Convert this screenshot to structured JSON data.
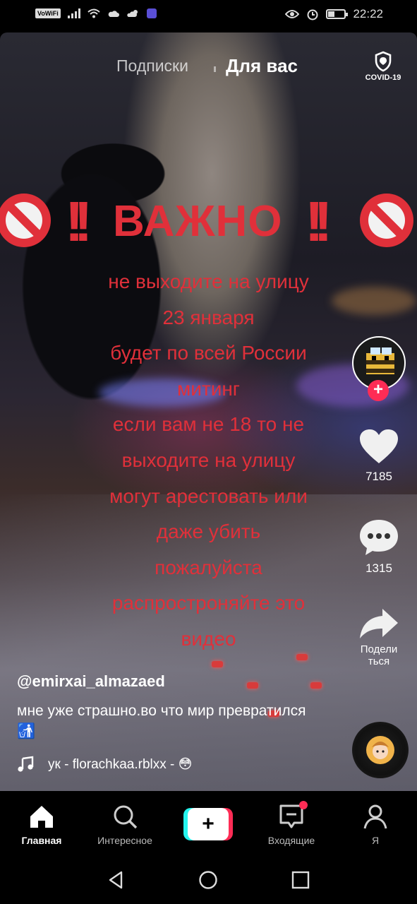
{
  "status_bar": {
    "vowifi": "VoWiFi",
    "time": "22:22"
  },
  "top_tabs": {
    "following": "Подписки",
    "for_you": "Для вас",
    "covid_label": "COVID-19"
  },
  "overlay": {
    "headline": "ВАЖНО",
    "bang": "!!",
    "lines": [
      "не выходите на улицу",
      "23 января",
      "будет по всей России",
      "митинг",
      "если вам не 18 то не",
      "выходите на улицу",
      "могут арестовать или",
      "даже убить",
      "пожалуйста",
      "распростроняйте это",
      "видео"
    ],
    "accent_color": "#e0303a"
  },
  "side_actions": {
    "likes": "7185",
    "comments": "1315",
    "share_label": "Подели\nться"
  },
  "caption": {
    "username": "@emirxai_almazaed",
    "description": "мне уже страшно.во что мир превратился🚮",
    "music": "ук - florachkaa.rblxx - 😳"
  },
  "bottom_nav": {
    "home": "Главная",
    "discover": "Интересное",
    "create": "+",
    "inbox": "Входящие",
    "profile": "Я"
  },
  "icons": [
    "home-icon",
    "search-icon",
    "inbox-icon",
    "profile-icon",
    "heart-icon",
    "comment-icon",
    "share-icon",
    "music-note-icon",
    "shield-icon",
    "no-entry-icon"
  ]
}
